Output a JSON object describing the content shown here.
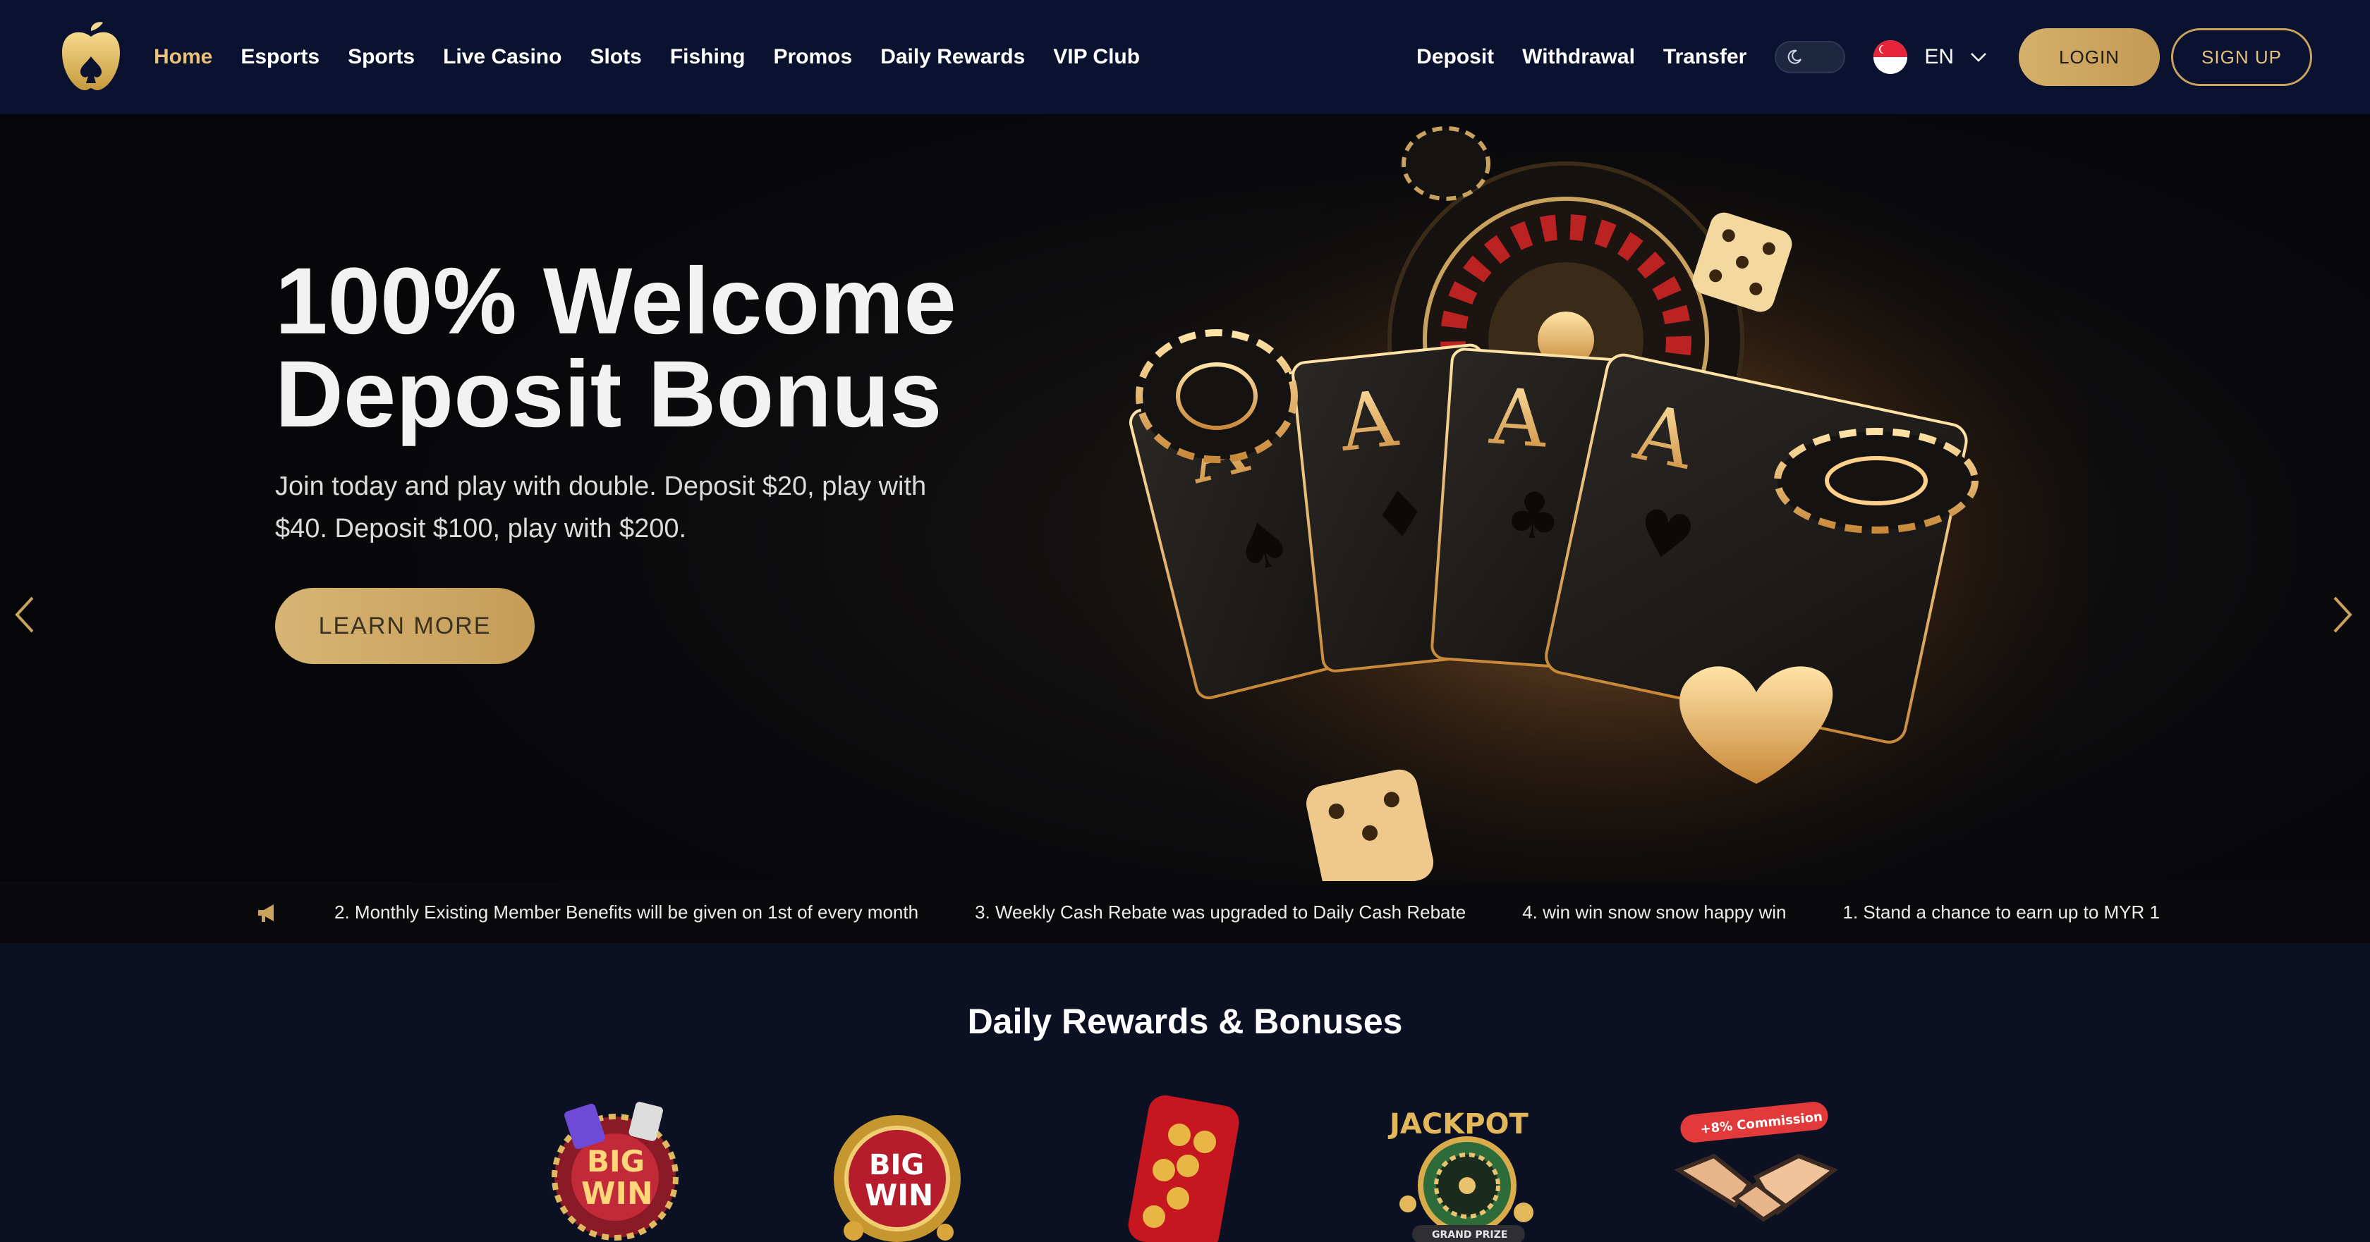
{
  "header": {
    "logo_icon": "golden-apple-spade-icon",
    "nav": [
      {
        "label": "Home",
        "active": true
      },
      {
        "label": "Esports"
      },
      {
        "label": "Sports"
      },
      {
        "label": "Live Casino"
      },
      {
        "label": "Slots"
      },
      {
        "label": "Fishing"
      },
      {
        "label": "Promos"
      },
      {
        "label": "Daily Rewards"
      },
      {
        "label": "VIP Club"
      }
    ],
    "quick_links": {
      "deposit": "Deposit",
      "withdrawal": "Withdrawal",
      "transfer": "Transfer"
    },
    "theme_toggle_icon": "moon-icon",
    "language": {
      "flag_icon": "singapore-flag-icon",
      "code": "EN"
    },
    "login_label": "LOGIN",
    "signup_label": "SIGN UP"
  },
  "hero": {
    "title": "100% Welcome Deposit Bonus",
    "subtitle": "Join today and play with double. Deposit $20, play with $40. Deposit $100, play with $200.",
    "cta_label": "LEARN MORE",
    "art": "playing-cards-aces-dice-roulette-chips",
    "slides_total": 1,
    "slide_current": 1
  },
  "announcements": [
    "2. Monthly Existing Member Benefits will be given on 1st of every month",
    "3. Weekly Cash Rebate was upgraded to Daily Cash Rebate",
    "4. win win snow snow happy win",
    "1. Stand a chance to earn up to MYR 1"
  ],
  "daily_rewards": {
    "title": "Daily Rewards & Bonuses",
    "items": [
      {
        "icon": "big-win-badge-icon"
      },
      {
        "icon": "big-win-roulette-icon"
      },
      {
        "icon": "red-envelope-coins-icon"
      },
      {
        "icon": "jackpot-roulette-icon",
        "text": "JACKPOT",
        "caption": "GRAND PRIZE"
      },
      {
        "icon": "handshake-commission-icon",
        "tag": "+8% Commission"
      }
    ]
  },
  "colors": {
    "accent_gold": "#e8c27a",
    "header_bg": "#0a1230",
    "page_bg": "#0b1022"
  }
}
